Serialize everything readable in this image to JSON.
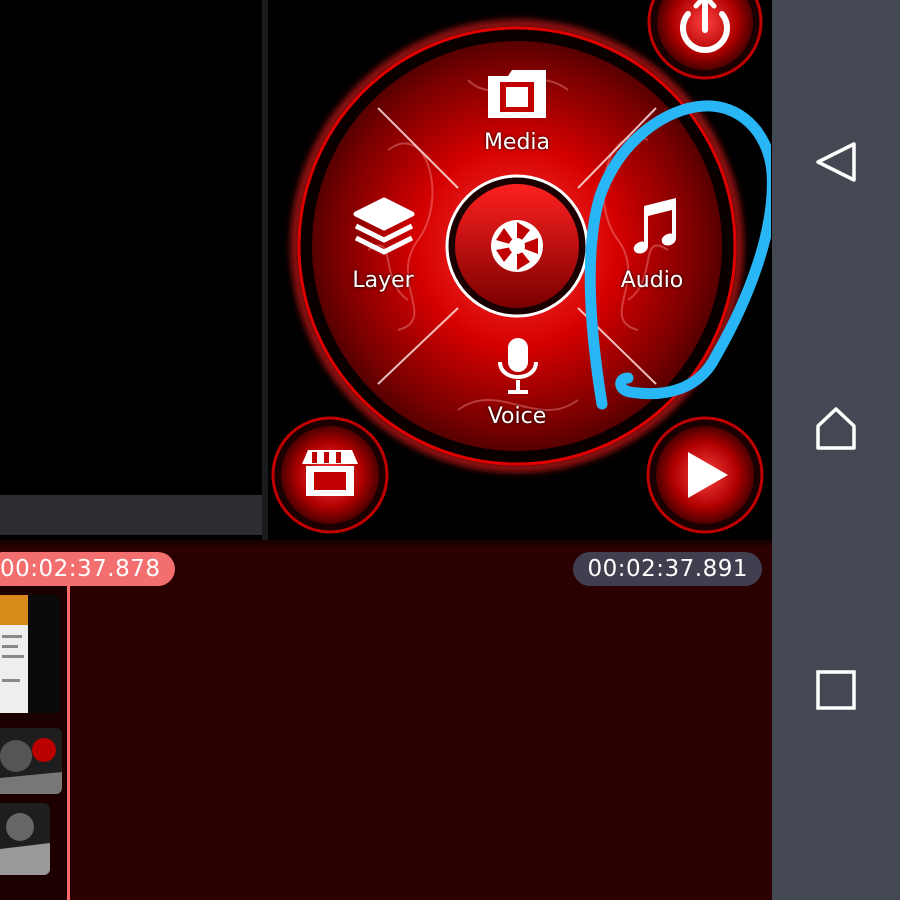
{
  "wheel_menu": {
    "media_label": "Media",
    "layer_label": "Layer",
    "audio_label": "Audio",
    "voice_label": "Voice",
    "center_icon": "camera-aperture-icon"
  },
  "corner_buttons": {
    "top_right_icon": "power-upload-icon",
    "store_icon": "store-icon",
    "play_icon": "play-icon"
  },
  "timeline": {
    "current_time": "00:02:37.878",
    "total_time": "00:02:37.891"
  },
  "nav": {
    "back_icon": "back-triangle-icon",
    "home_icon": "home-icon",
    "recents_icon": "recents-square-icon"
  },
  "colors": {
    "accent_red": "#e60000",
    "annotation_blue": "#29b6f6",
    "timeline_bg": "#2a0000",
    "nav_bg": "#444853"
  }
}
